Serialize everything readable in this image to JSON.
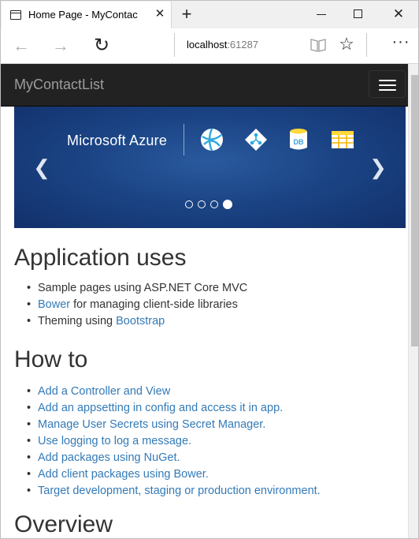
{
  "browser": {
    "tab_title": "Home Page - MyContac",
    "new_tab": "+",
    "close_tab": "✕",
    "url_host": "localhost",
    "url_port": ":61287",
    "icons": [
      "tab-page-icon",
      "back-icon",
      "forward-icon",
      "refresh-icon",
      "reading-view-icon",
      "favorite-star-icon",
      "more-icon",
      "minimize-icon",
      "maximize-icon",
      "close-icon"
    ]
  },
  "site": {
    "brand": "MyContactList"
  },
  "carousel": {
    "title": "Microsoft Azure",
    "db_label": "DB",
    "slide_count": 4,
    "active_slide": 4,
    "colors": {
      "bg": "#1b4485",
      "accent": "#2fa8e0",
      "db": "#3aa0dc"
    }
  },
  "sections": {
    "app_uses": {
      "title": "Application uses",
      "item1": "Sample pages using ASP.NET Core MVC",
      "item2_link": "Bower",
      "item2_rest": " for managing client-side libraries",
      "item3_pre": "Theming using ",
      "item3_link": "Bootstrap"
    },
    "how_to": {
      "title": "How to",
      "items": [
        "Add a Controller and View",
        "Add an appsetting in config and access it in app.",
        "Manage User Secrets using Secret Manager.",
        "Use logging to log a message.",
        "Add packages using NuGet.",
        "Add client packages using Bower.",
        "Target development, staging or production environment."
      ]
    },
    "overview": {
      "title": "Overview"
    }
  },
  "colors": {
    "link": "#337ab7",
    "navbar": "#222222",
    "brand": "#9d9d9d"
  }
}
